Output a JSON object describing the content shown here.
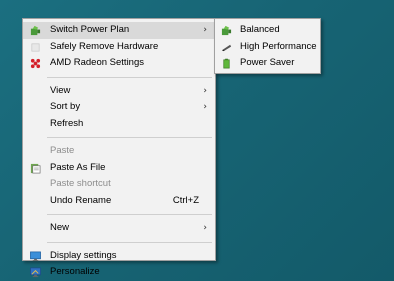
{
  "main_menu": {
    "switch_power_plan": "Switch Power Plan",
    "safely_remove_hardware": "Safely Remove Hardware",
    "amd_radeon_settings": "AMD Radeon Settings",
    "view": "View",
    "sort_by": "Sort by",
    "refresh": "Refresh",
    "paste": "Paste",
    "paste_as_file": "Paste As File",
    "paste_shortcut": "Paste shortcut",
    "undo_rename": "Undo Rename",
    "undo_rename_shortcut": "Ctrl+Z",
    "new": "New",
    "display_settings": "Display settings",
    "personalize": "Personalize"
  },
  "power_plan_submenu": {
    "balanced": "Balanced",
    "high_performance": "High Performance",
    "power_saver": "Power Saver"
  },
  "icons": {
    "switch_power_plan": "power-plan-icon",
    "safely_remove_hardware": "usb-icon",
    "amd_radeon_settings": "amd-radeon-icon",
    "paste_as_file": "paste-as-file-icon",
    "display_settings": "display-icon",
    "personalize": "personalize-icon",
    "balanced": "balanced-plan-icon",
    "high_performance": "high-performance-icon",
    "power_saver": "power-saver-icon"
  },
  "colors": {
    "desktop_background": "#176474",
    "menu_background": "#f2f2f2",
    "highlight": "#d9d9d9",
    "disabled_text": "#8d8d8d"
  }
}
